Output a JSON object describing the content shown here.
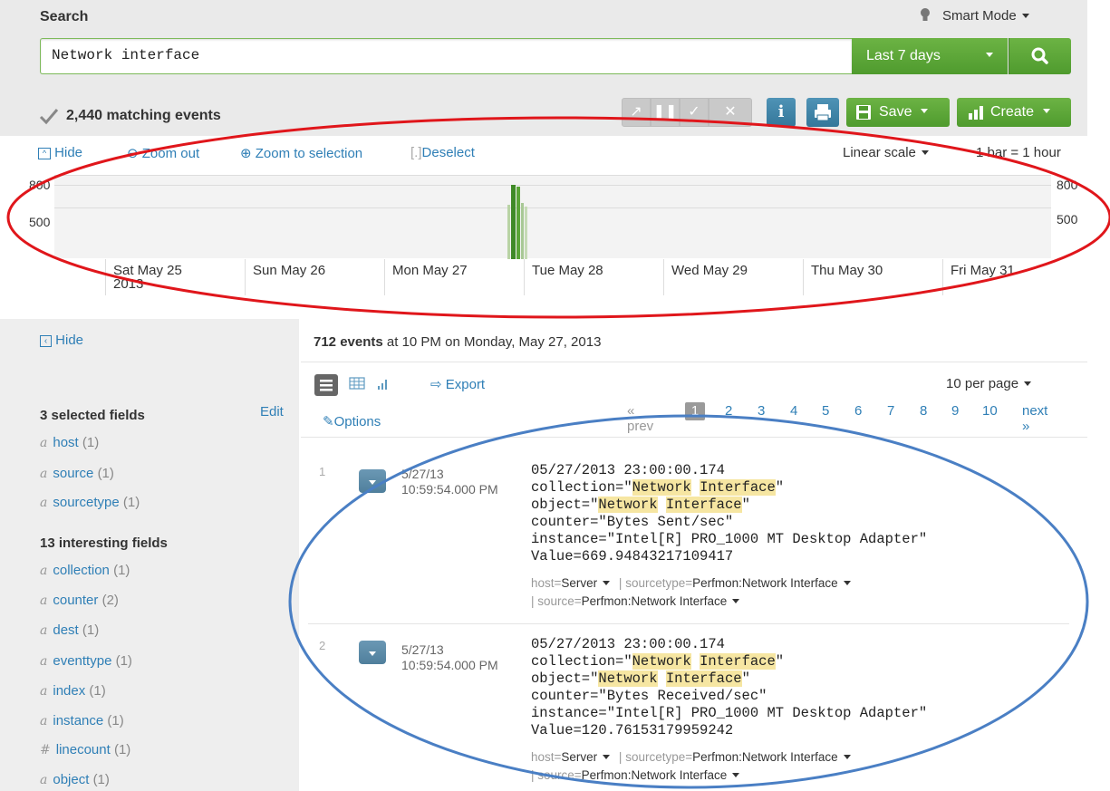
{
  "search": {
    "heading": "Search",
    "mode": "Smart Mode",
    "query": "Network interface",
    "time_range": "Last 7 days"
  },
  "status": {
    "matching": "2,440 matching events"
  },
  "toolbar": {
    "save_label": "Save",
    "create_label": "Create"
  },
  "timeline": {
    "hide_label": "Hide",
    "zoom_out_label": "Zoom out",
    "zoom_selection_label": "Zoom to selection",
    "deselect_label": "Deselect",
    "scale_label": "Linear scale",
    "bar_label": "1 bar = 1 hour",
    "y_labels": [
      "800",
      "500"
    ],
    "ticks": [
      "Sat May 25",
      "Sun May 26",
      "Mon May 27",
      "Tue May 28",
      "Wed May 29",
      "Thu May 30",
      "Fri May 31"
    ],
    "year": "2013"
  },
  "sidebar": {
    "hide_label": "Hide",
    "selected_heading": "3 selected fields",
    "edit_label": "Edit",
    "selected_fields": [
      {
        "type": "a",
        "name": "host",
        "count": "(1)"
      },
      {
        "type": "a",
        "name": "source",
        "count": "(1)"
      },
      {
        "type": "a",
        "name": "sourcetype",
        "count": "(1)"
      }
    ],
    "interesting_heading": "13 interesting fields",
    "interesting_fields": [
      {
        "type": "a",
        "name": "collection",
        "count": "(1)"
      },
      {
        "type": "a",
        "name": "counter",
        "count": "(2)"
      },
      {
        "type": "a",
        "name": "dest",
        "count": "(1)"
      },
      {
        "type": "a",
        "name": "eventtype",
        "count": "(1)"
      },
      {
        "type": "a",
        "name": "index",
        "count": "(1)"
      },
      {
        "type": "a",
        "name": "instance",
        "count": "(1)"
      },
      {
        "type": "#",
        "name": "linecount",
        "count": "(1)"
      },
      {
        "type": "a",
        "name": "object",
        "count": "(1)"
      }
    ]
  },
  "events": {
    "count_bold": "712 events",
    "count_rest": " at 10 PM on Monday, May 27, 2013",
    "export_label": "Export",
    "options_label": "Options",
    "per_page": "10 per page",
    "pager": {
      "prev": "« prev",
      "pages": [
        "1",
        "2",
        "3",
        "4",
        "5",
        "6",
        "7",
        "8",
        "9",
        "10"
      ],
      "next": "next »"
    },
    "rows": [
      {
        "num": "1",
        "date": "5/27/13",
        "time": "10:59:54.000 PM",
        "timestamp": "05/27/2013 23:00:00.174",
        "collection_pre": "collection=\"",
        "collection_hl1": "Network",
        "collection_hl2": "Interface",
        "object_pre": "object=\"",
        "object_hl1": "Network",
        "object_hl2": "Interface",
        "counter": "counter=\"Bytes Sent/sec\"",
        "instance": "instance=\"Intel[R] PRO_1000 MT Desktop Adapter\"",
        "value": "Value=669.94843217109417",
        "host_key": "host=",
        "host_val": "Server",
        "sourcetype_key": "sourcetype=",
        "sourcetype_val": "Perfmon:Network Interface",
        "source_key": "source=",
        "source_val": "Perfmon:Network Interface"
      },
      {
        "num": "2",
        "date": "5/27/13",
        "time": "10:59:54.000 PM",
        "timestamp": "05/27/2013 23:00:00.174",
        "collection_pre": "collection=\"",
        "collection_hl1": "Network",
        "collection_hl2": "Interface",
        "object_pre": "object=\"",
        "object_hl1": "Network",
        "object_hl2": "Interface",
        "counter": "counter=\"Bytes Received/sec\"",
        "instance": "instance=\"Intel[R] PRO_1000 MT Desktop Adapter\"",
        "value": "Value=120.76153179959242",
        "host_key": "host=",
        "host_val": "Server",
        "sourcetype_key": "sourcetype=",
        "sourcetype_val": "Perfmon:Network Interface",
        "source_key": "source=",
        "source_val": "Perfmon:Network Interface"
      }
    ]
  },
  "colors": {
    "accent_green": "#5aa537",
    "link_blue": "#2f7fb6",
    "annotation_red": "#e0161b",
    "annotation_blue": "#4a7fc4"
  }
}
